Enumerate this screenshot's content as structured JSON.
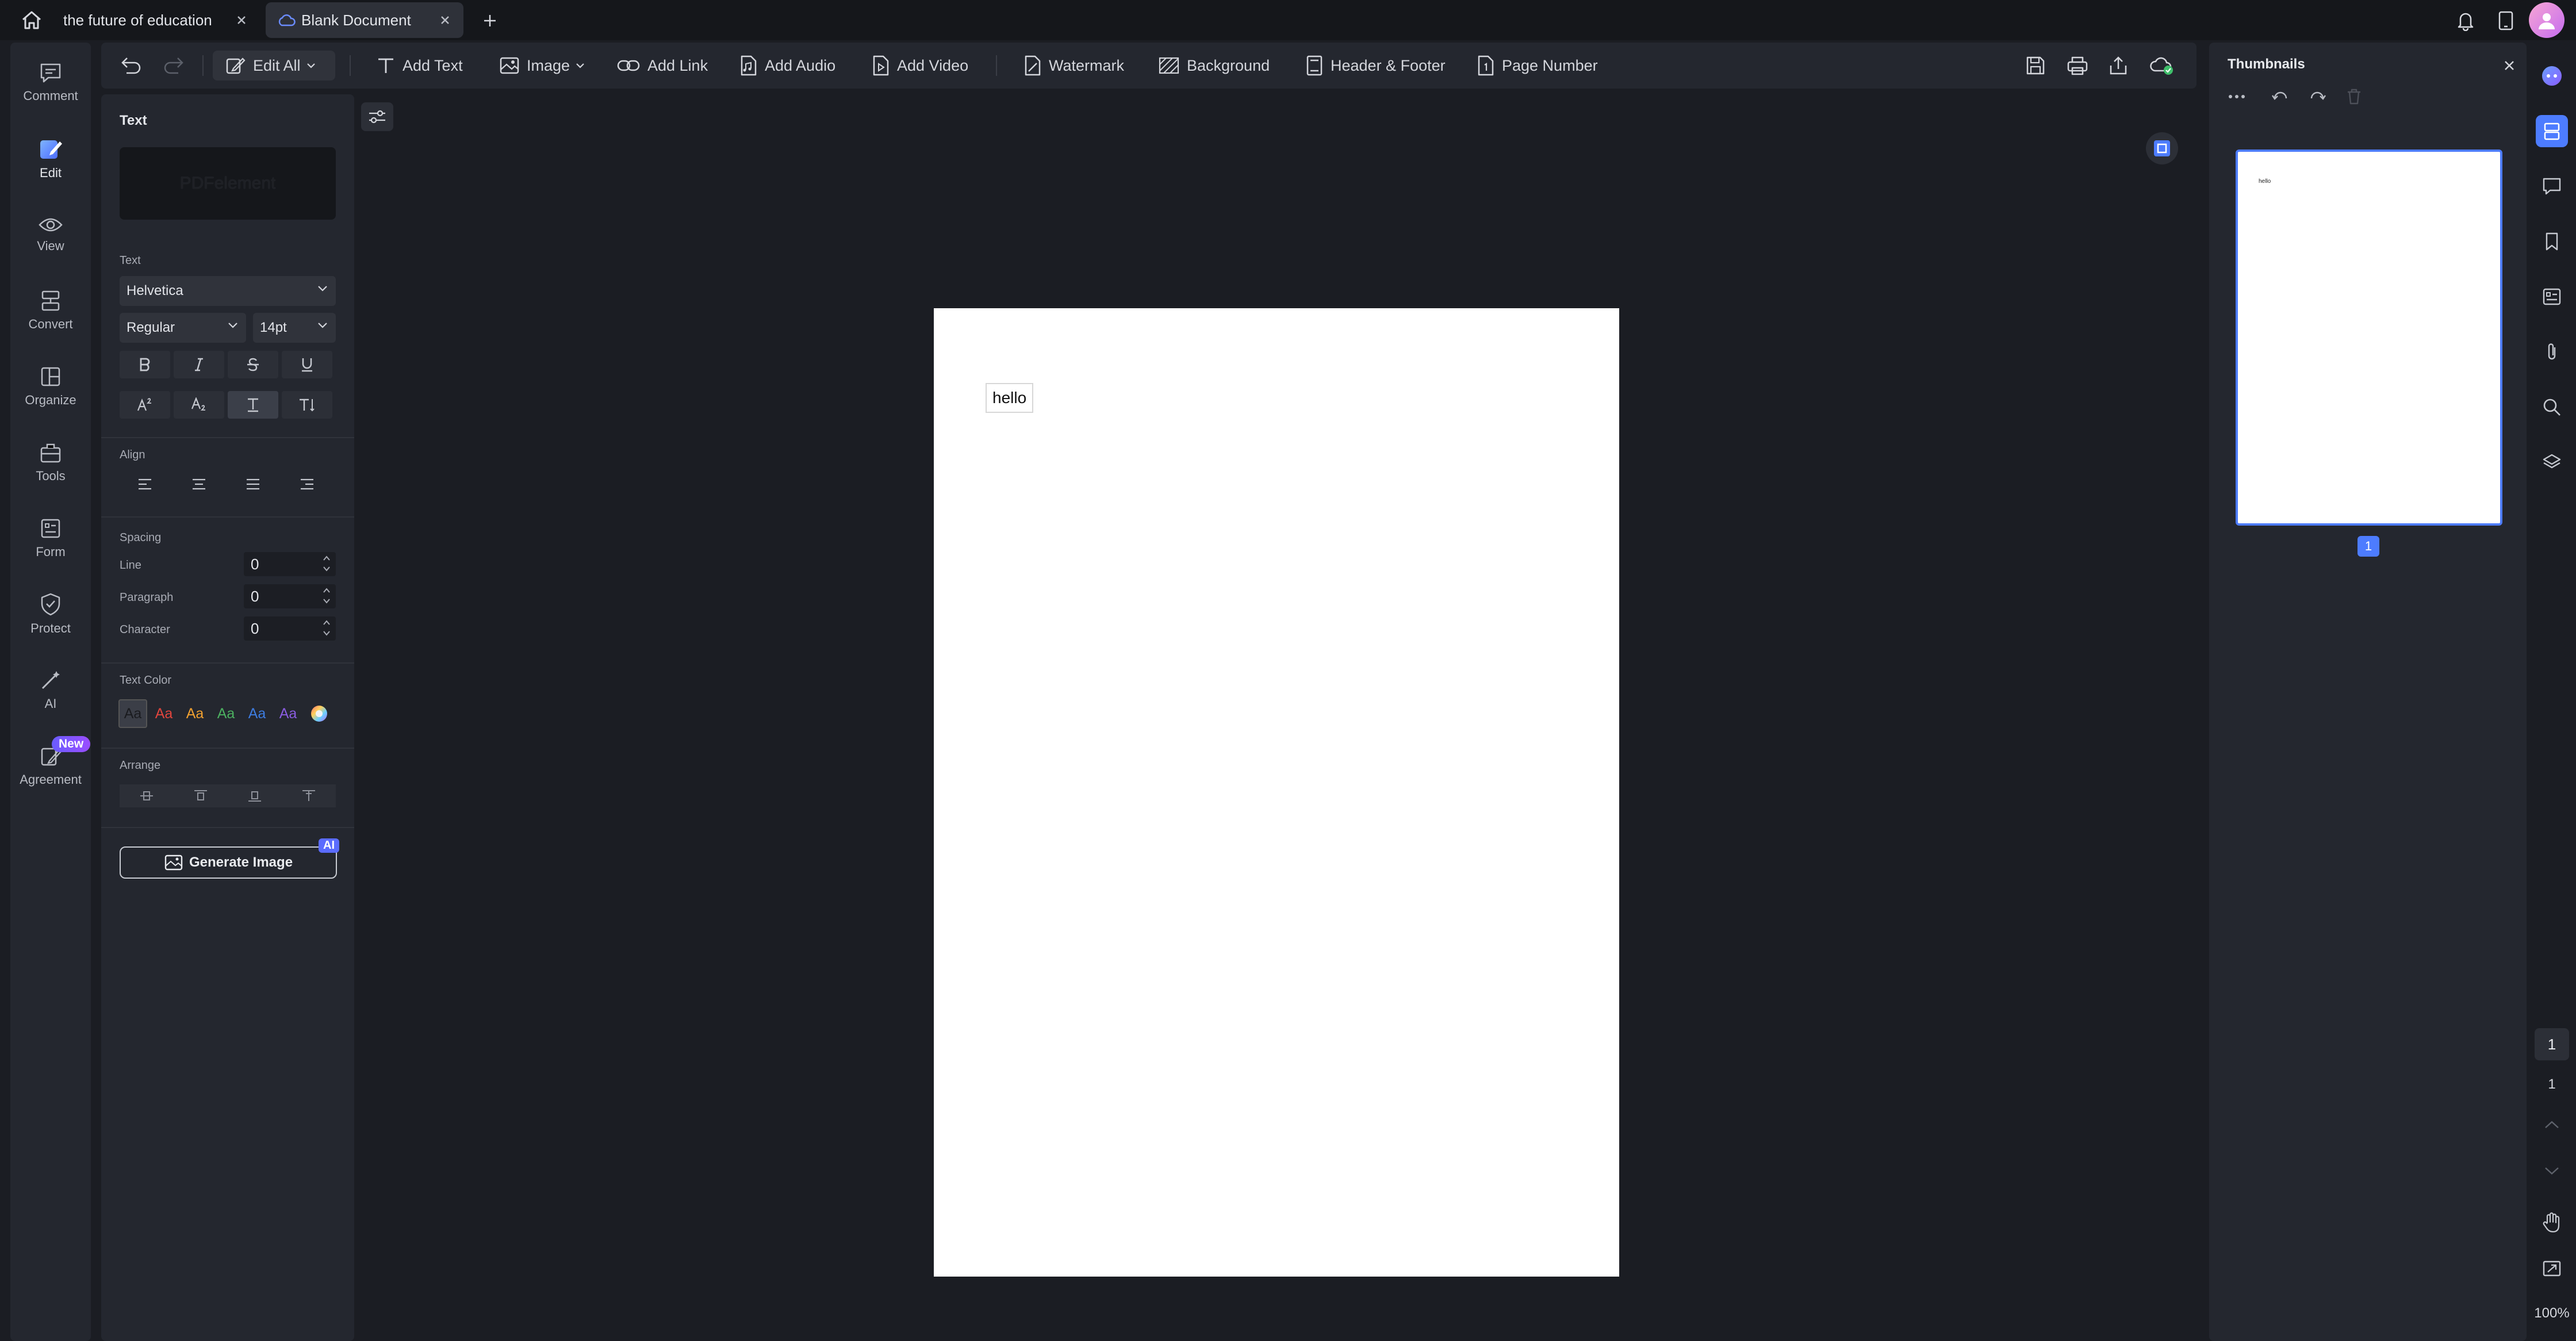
{
  "tabs": [
    {
      "label": "the future of education"
    },
    {
      "label": "Blank Document"
    }
  ],
  "icons": {
    "home": "home-icon",
    "close": "close-icon",
    "add": "plus-icon",
    "bell": "bell-icon",
    "tablet": "tablet-icon",
    "cloud": "cloud-icon"
  },
  "left_nav": [
    {
      "label": "Comment",
      "icon": "comment-icon"
    },
    {
      "label": "Edit",
      "icon": "edit-icon"
    },
    {
      "label": "View",
      "icon": "eye-icon"
    },
    {
      "label": "Convert",
      "icon": "convert-icon"
    },
    {
      "label": "Organize",
      "icon": "organize-icon"
    },
    {
      "label": "Tools",
      "icon": "toolbox-icon"
    },
    {
      "label": "Form",
      "icon": "form-icon"
    },
    {
      "label": "Protect",
      "icon": "shield-icon"
    },
    {
      "label": "AI",
      "icon": "magic-wand-icon"
    },
    {
      "label": "Agreement",
      "icon": "agreement-icon",
      "badge": "New"
    }
  ],
  "toolbar": {
    "edit_all": "Edit All",
    "add_text": "Add Text",
    "image": "Image",
    "add_link": "Add Link",
    "add_audio": "Add Audio",
    "add_video": "Add Video",
    "watermark": "Watermark",
    "background": "Background",
    "header_footer": "Header & Footer",
    "page_number": "Page Number"
  },
  "props": {
    "title": "Text",
    "preview": "PDFelement",
    "text_section": "Text",
    "font": "Helvetica",
    "weight": "Regular",
    "size": "14pt",
    "align_section": "Align",
    "spacing_section": "Spacing",
    "line_label": "Line",
    "line_value": "0",
    "paragraph_label": "Paragraph",
    "paragraph_value": "0",
    "character_label": "Character",
    "character_value": "0",
    "color_section": "Text Color",
    "swatch_text": "Aa",
    "swatch_colors": [
      "#2f3138",
      "#e0453d",
      "#f0a030",
      "#4cb060",
      "#3d7ce0",
      "#8a5ce0"
    ],
    "arrange_section": "Arrange",
    "generate_image": "Generate Image",
    "ai_badge": "AI"
  },
  "document": {
    "text": "hello"
  },
  "thumbnails": {
    "title": "Thumbnails",
    "page_text": "hello",
    "page_number": "1"
  },
  "right_rail": {
    "current_page": "1",
    "total_pages": "1",
    "zoom": "100%"
  },
  "accent_color": "#4d7cff"
}
